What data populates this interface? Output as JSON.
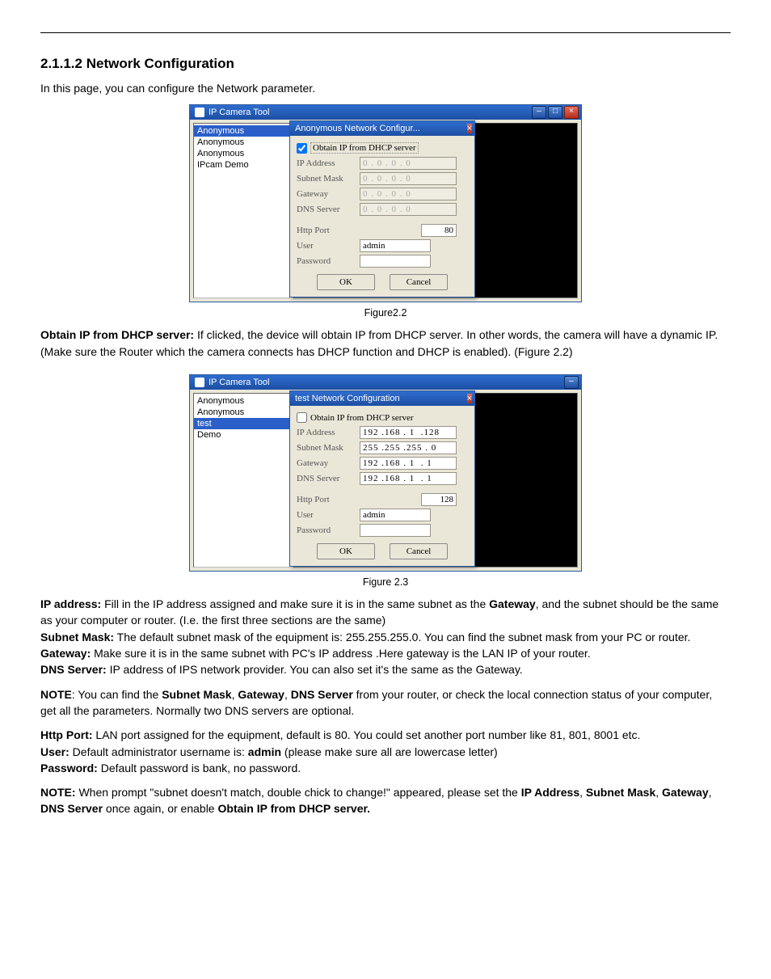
{
  "heading": "2.1.1.2 Network Configuration",
  "intro": "In this page, you can configure the Network parameter.",
  "figure22_caption": "Figure2.2",
  "figure23_caption": "Figure 2.3",
  "text_dhcp_label": "Obtain IP from DHCP server:",
  "text_dhcp_body": " If clicked, the device will obtain IP from DHCP server. In other words, the camera will have a dynamic IP. (Make sure the Router which the camera connects has DHCP function and DHCP is enabled). (Figure 2.2)",
  "ip_addr_label": "IP address:",
  "ip_addr_body_a": " Fill in the IP address assigned and make sure it is in the same subnet as the ",
  "ip_addr_gateway_word": "Gateway",
  "ip_addr_body_b": ", and the subnet should be the same as your computer or router. (I.e. the first three sections are the same)",
  "subnet_label": "Subnet Mask:",
  "subnet_body": " The default subnet mask of the equipment is: 255.255.255.0. You can find the subnet mask from your PC or router.",
  "gateway_label": "Gateway:",
  "gateway_body": " Make sure it is in the same subnet with PC's IP address .Here gateway is the LAN IP of your router.",
  "dns_label": "DNS Server:",
  "dns_body": " IP address of IPS network provider. You can also set it's the same as the Gateway.",
  "note1_label": "NOTE",
  "note1_body_a": ": You can find the ",
  "note1_sm": "Subnet Mask",
  "note1_sep1": ", ",
  "note1_gw": "Gateway",
  "note1_sep2": ", ",
  "note1_dns": "DNS Server",
  "note1_body_b": " from your router, or check the local connection status of your computer, get all the parameters. Normally two DNS servers are optional.",
  "httpport_label": "Http Port:",
  "httpport_body": " LAN port assigned for the equipment, default is 80. You could set another port number like 81, 801, 8001 etc.",
  "user_label": "User:",
  "user_body_a": " Default administrator username is: ",
  "user_admin": "admin",
  "user_body_b": " (please make sure all are lowercase letter)",
  "pwd_label": "Password:",
  "pwd_body": " Default password is bank, no password.",
  "note2_label": "NOTE:",
  "note2_body_a": " When prompt \"subnet doesn't match, double chick to change!\" appeared, please set the ",
  "note2_ip": "IP Address",
  "note2_sep1": ", ",
  "note2_sm": "Subnet Mask",
  "note2_sep2": ", ",
  "note2_gw": "Gateway",
  "note2_sep3": ", ",
  "note2_dns": "DNS Server",
  "note2_body_b": " once again, or enable ",
  "note2_dhcp": "Obtain IP from DHCP server.",
  "ss1": {
    "app_title": "IP Camera Tool",
    "sidebar": [
      "Anonymous",
      "Anonymous",
      "Anonymous",
      "IPcam Demo"
    ],
    "dialog_title": "Anonymous Network Configur...",
    "chk_label": "Obtain IP from DHCP server",
    "chk_checked": true,
    "rows": {
      "ip": "IP Address",
      "subnet": "Subnet Mask",
      "gateway": "Gateway",
      "dns": "DNS Server",
      "http": "Http Port",
      "user": "User",
      "password": "Password"
    },
    "vals": {
      "ip": "0 . 0 . 0 . 0",
      "subnet": "0 . 0 . 0 . 0",
      "gateway": "0 . 0 . 0 . 0",
      "dns": "0 . 0 . 0 . 0",
      "http": "80",
      "user": "admin",
      "password": ""
    },
    "ok": "OK",
    "cancel": "Cancel",
    "close_x": "×",
    "min": "–",
    "max": "□"
  },
  "ss2": {
    "app_title": "IP Camera Tool",
    "sidebar": [
      "Anonymous",
      "Anonymous",
      "test",
      "Demo"
    ],
    "sidebar_sel_index": 2,
    "dialog_title": "test Network Configuration",
    "chk_label": "Obtain IP from DHCP server",
    "chk_checked": false,
    "rows": {
      "ip": "IP Address",
      "subnet": "Subnet Mask",
      "gateway": "Gateway",
      "dns": "DNS Server",
      "http": "Http Port",
      "user": "User",
      "password": "Password"
    },
    "vals": {
      "ip": "192 .168 . 1  .128",
      "subnet": "255 .255 .255 . 0",
      "gateway": "192 .168 . 1  . 1",
      "dns": "192 .168 . 1  . 1",
      "http": "128",
      "user": "admin",
      "password": ""
    },
    "ok": "OK",
    "cancel": "Cancel",
    "close_x": "×",
    "min": "–"
  }
}
